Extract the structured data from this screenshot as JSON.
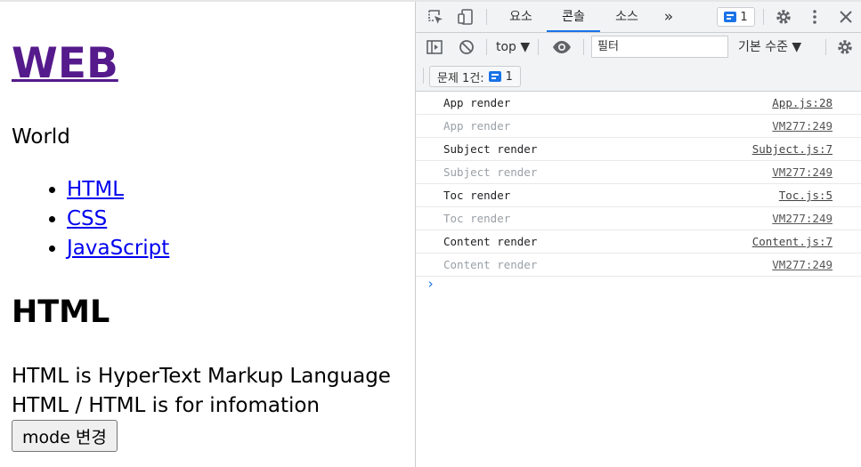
{
  "page": {
    "title": "WEB",
    "subtitle": "World",
    "nav_items": [
      "HTML",
      "CSS",
      "JavaScript"
    ],
    "article_title": "HTML",
    "article_desc": "HTML is HyperText Markup Language",
    "article_extra": "HTML / HTML is for infomation",
    "mode_button": "mode 변경"
  },
  "devtools": {
    "tabs": {
      "elements": "요소",
      "console": "콘솔",
      "sources": "소스",
      "more": "»"
    },
    "issues_badge_count": "1",
    "context": "top ▼",
    "filter_placeholder": "필터",
    "levels": "기본 수준 ▼",
    "issues_label": "문제 1건:",
    "issues_count": "1",
    "logs": [
      {
        "msg": "App render",
        "src": "App.js:28",
        "dim": false
      },
      {
        "msg": "App render",
        "src": "VM277:249",
        "dim": true
      },
      {
        "msg": "Subject render",
        "src": "Subject.js:7",
        "dim": false
      },
      {
        "msg": "Subject render",
        "src": "VM277:249",
        "dim": true
      },
      {
        "msg": "Toc render",
        "src": "Toc.js:5",
        "dim": false
      },
      {
        "msg": "Toc render",
        "src": "VM277:249",
        "dim": true
      },
      {
        "msg": "Content render",
        "src": "Content.js:7",
        "dim": false
      },
      {
        "msg": "Content render",
        "src": "VM277:249",
        "dim": true
      }
    ],
    "prompt": "›"
  },
  "colors": {
    "accent": "#1a73e8",
    "visited_link": "#551a8b",
    "link": "#0000ee"
  }
}
